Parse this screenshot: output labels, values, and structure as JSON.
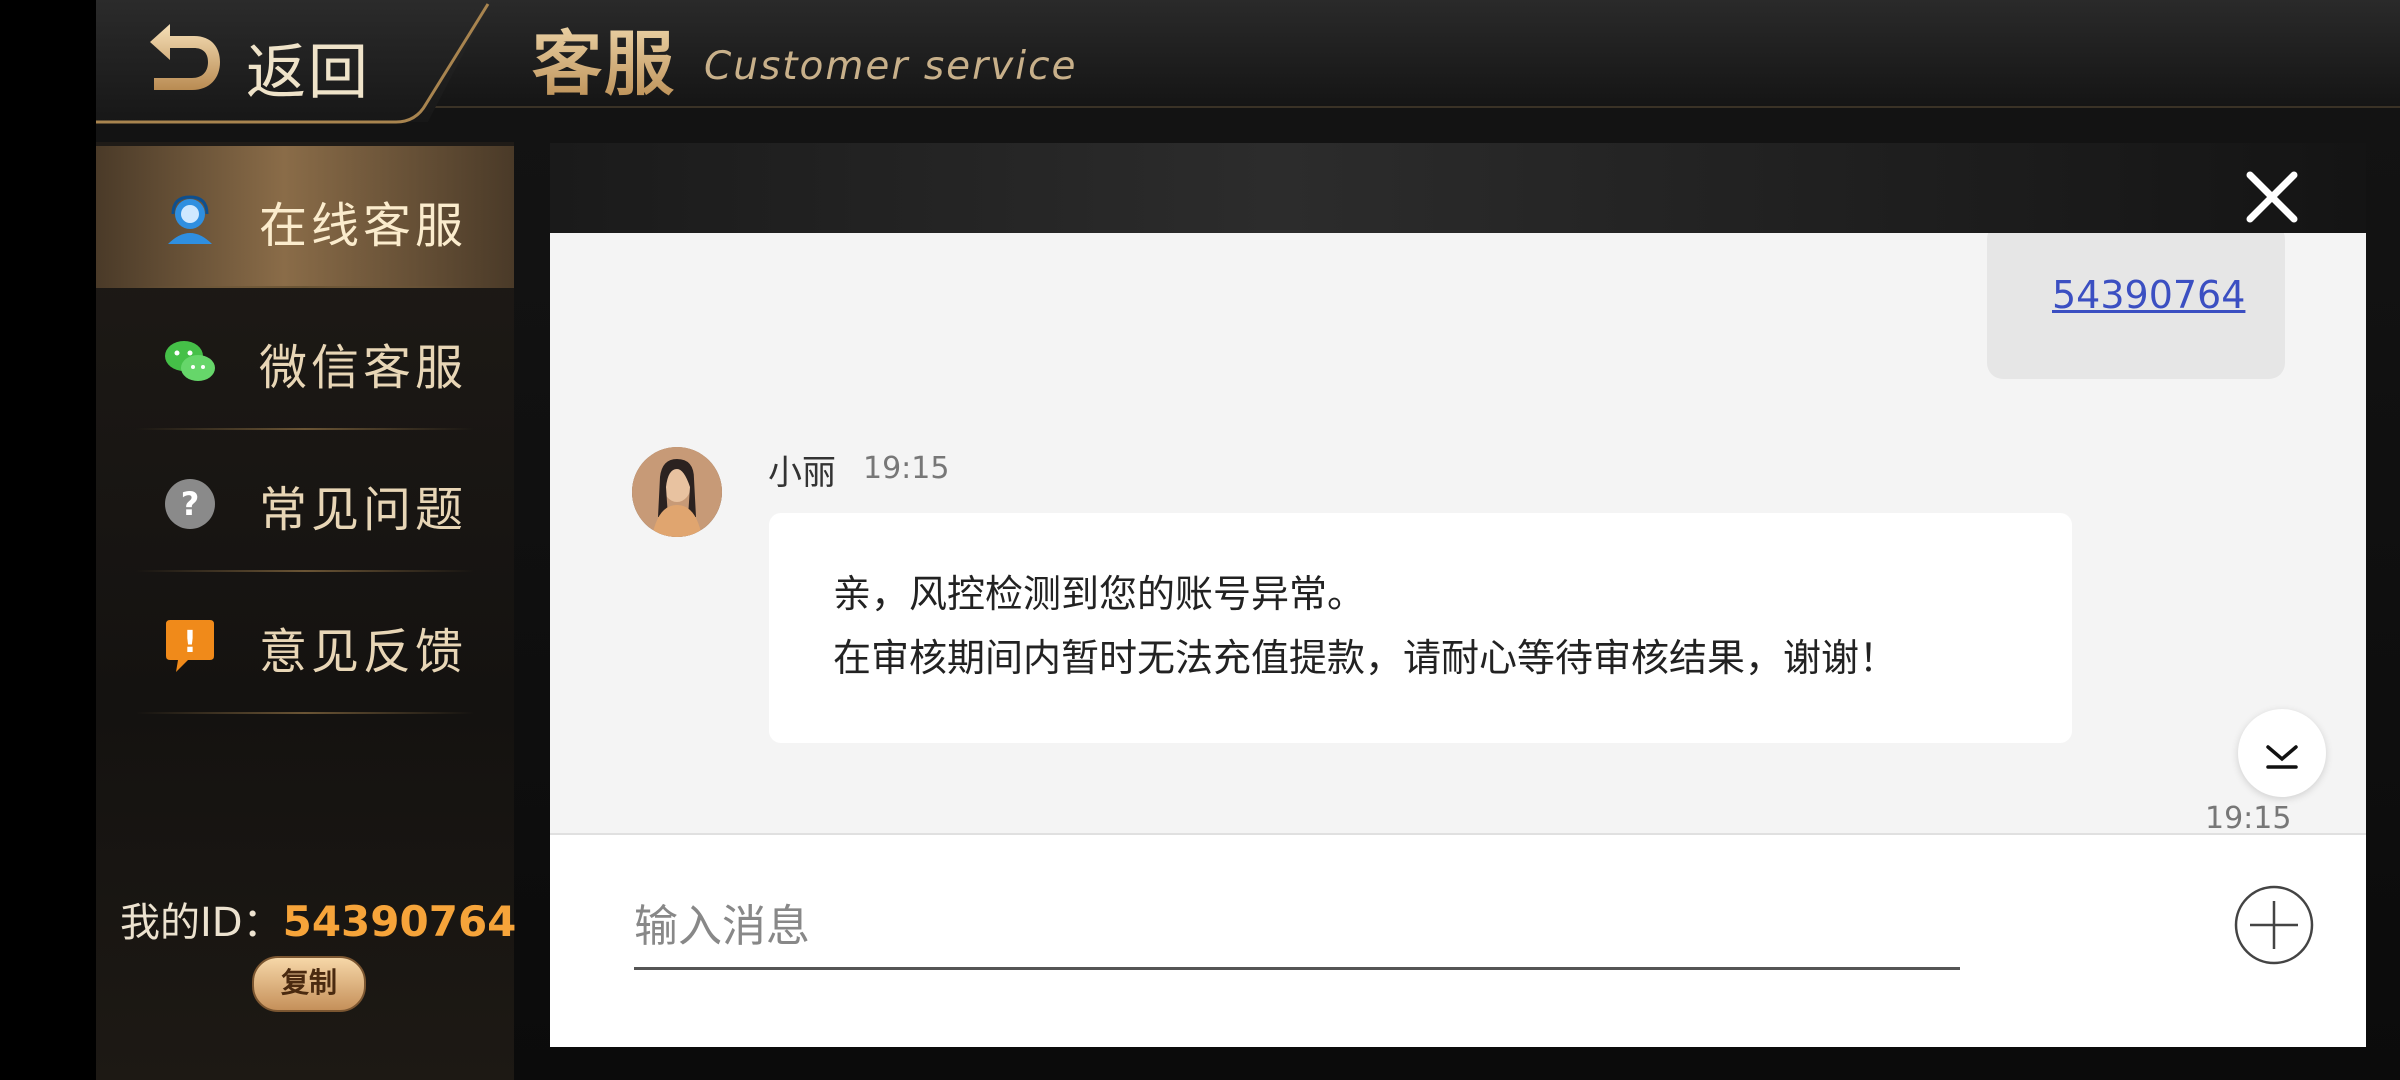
{
  "header": {
    "back_label": "返回",
    "title_cn": "客服",
    "title_en": "Customer service"
  },
  "sidebar": {
    "items": [
      {
        "label": "在线客服",
        "icon": "agent-icon",
        "active": true
      },
      {
        "label": "微信客服",
        "icon": "wechat-icon",
        "active": false
      },
      {
        "label": "常见问题",
        "icon": "question-icon",
        "active": false
      },
      {
        "label": "意见反馈",
        "icon": "feedback-icon",
        "active": false
      }
    ],
    "my_id_label": "我的ID：",
    "my_id_value": "54390764",
    "copy_label": "复制"
  },
  "chat": {
    "outgoing_link": "54390764",
    "agent_name": "小丽",
    "agent_time": "19:15",
    "message_line1": "亲，风控检测到您的账号异常。",
    "message_line2": "在审核期间内暂时无法充值提款，请耐心等待审核结果，谢谢！",
    "bottom_timestamp": "19:15"
  },
  "composer": {
    "placeholder": "输入消息"
  },
  "colors": {
    "accent_gold": "#d9b683",
    "id_orange": "#f6a43a",
    "link_blue": "#3b4fc2"
  }
}
